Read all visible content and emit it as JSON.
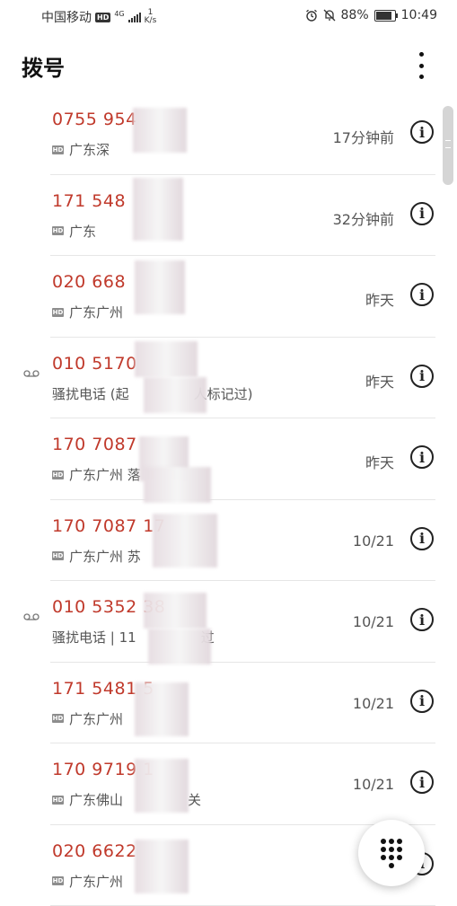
{
  "status": {
    "carrier": "中国移动",
    "hd": "HD",
    "network": "4G",
    "speed_value": "1",
    "speed_unit": "K/s",
    "battery_pct": "88%",
    "battery_level": 0.88,
    "time": "10:49"
  },
  "header": {
    "title": "拨号"
  },
  "calls": [
    {
      "number": "0755 954",
      "sub_prefix": "广东深",
      "sub_suffix": "",
      "time": "17分钟前",
      "hd": true,
      "voicemail": false
    },
    {
      "number": "171 548",
      "sub_prefix": "广东",
      "sub_suffix": "",
      "time": "32分钟前",
      "hd": true,
      "voicemail": false
    },
    {
      "number": "020 668",
      "sub_prefix": "广东广州",
      "sub_suffix": "",
      "time": "昨天",
      "hd": true,
      "voicemail": false
    },
    {
      "number": "010 5170",
      "sub_prefix": "骚扰电话 (起",
      "sub_suffix": "人标记过)",
      "time": "昨天",
      "hd": false,
      "voicemail": true
    },
    {
      "number": "170 7087",
      "sub_prefix": "广东广州 落",
      "sub_suffix": "",
      "time": "昨天",
      "hd": true,
      "voicemail": false
    },
    {
      "number": "170 7087 17",
      "sub_prefix": "广东广州 苏",
      "sub_suffix": "",
      "time": "10/21",
      "hd": true,
      "voicemail": false
    },
    {
      "number": "010 5352 38",
      "sub_prefix": "骚扰电话 | 11",
      "sub_suffix": "过",
      "time": "10/21",
      "hd": false,
      "voicemail": true
    },
    {
      "number": "171 5481 5",
      "sub_prefix": "广东广州",
      "sub_suffix": "",
      "time": "10/21",
      "hd": true,
      "voicemail": false
    },
    {
      "number": "170 9719 1",
      "sub_prefix": "广东佛山",
      "sub_suffix": "关",
      "time": "10/21",
      "hd": true,
      "voicemail": false
    },
    {
      "number": "020 6622",
      "sub_prefix": "广东广州",
      "sub_suffix": "",
      "time": "",
      "hd": true,
      "voicemail": false
    }
  ]
}
